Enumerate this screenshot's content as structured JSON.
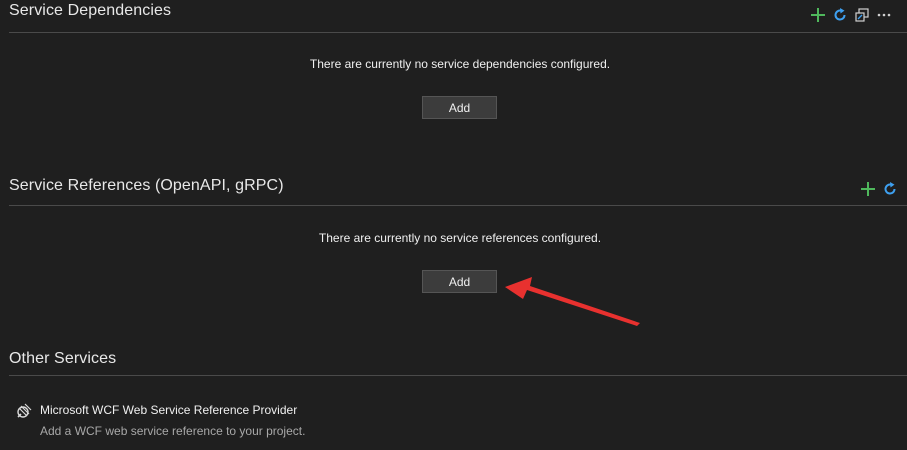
{
  "service_dependencies": {
    "title": "Service Dependencies",
    "empty_message": "There are currently no service dependencies configured.",
    "add_label": "Add",
    "toolbar": [
      "add-icon",
      "refresh-icon",
      "restore-icon",
      "more-icon"
    ]
  },
  "service_references": {
    "title": "Service References (OpenAPI, gRPC)",
    "empty_message": "There are currently no service references configured.",
    "add_label": "Add",
    "toolbar": [
      "add-icon",
      "refresh-icon"
    ]
  },
  "other_services": {
    "title": "Other Services",
    "providers": [
      {
        "name": "Microsoft WCF Web Service Reference Provider",
        "description": "Add a WCF web service reference to your project.",
        "icon": "wcf-provider-icon"
      }
    ]
  },
  "colors": {
    "background": "#1f1f1f",
    "add_icon": "#4fb85c",
    "refresh_icon": "#3ea0f0",
    "annotation": "#e8312f"
  }
}
